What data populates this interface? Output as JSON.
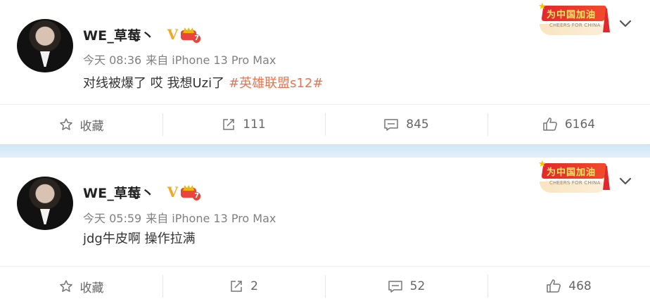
{
  "posts": [
    {
      "username": "WE_草莓丶",
      "verified_mark": "V",
      "level_badge": "7",
      "time": "今天 08:36",
      "source": "来自 iPhone 13 Pro Max",
      "text": "对线被爆了 哎 我想Uzi了",
      "hashtag": "#英雄联盟s12#",
      "banner_text": "为中国加油",
      "banner_sub": "CHEERS FOR CHINA",
      "actions": {
        "favorite": "收藏",
        "repost": "111",
        "comment": "845",
        "like": "6164"
      }
    },
    {
      "username": "WE_草莓丶",
      "verified_mark": "V",
      "level_badge": "7",
      "time": "今天 05:59",
      "source": "来自 iPhone 13 Pro Max",
      "text": "jdg牛皮啊 操作拉满",
      "hashtag": "",
      "banner_text": "为中国加油",
      "banner_sub": "CHEERS FOR CHINA",
      "actions": {
        "favorite": "收藏",
        "repost": "2",
        "comment": "52",
        "like": "468"
      }
    }
  ],
  "colors": {
    "hashtag": "#eb7350",
    "verified": "#f5a623",
    "separator_band": "#d8ebf8"
  },
  "icons": [
    "star-icon",
    "repost-icon",
    "comment-icon",
    "like-icon",
    "chevron-down-icon"
  ]
}
